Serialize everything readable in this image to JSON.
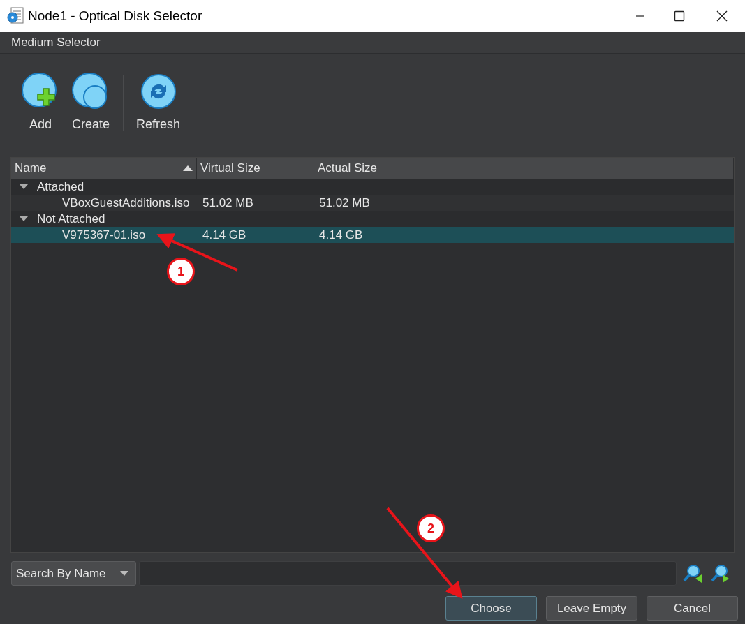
{
  "window": {
    "title": "Node1 - Optical Disk Selector"
  },
  "menu": [
    "Medium Selector"
  ],
  "toolbar": [
    {
      "label": "Add",
      "kind": "add"
    },
    {
      "label": "Create",
      "kind": "create"
    },
    {
      "label": "Refresh",
      "kind": "refresh"
    }
  ],
  "table": {
    "columns": [
      {
        "label": "Name",
        "sorted": true
      },
      {
        "label": "Virtual Size",
        "sorted": false
      },
      {
        "label": "Actual Size",
        "sorted": false
      }
    ],
    "groups": [
      {
        "label": "Attached",
        "expanded": true,
        "children": [
          {
            "name": "VBoxGuestAdditions.iso",
            "virtual_size": "51.02 MB",
            "actual_size": "51.02 MB",
            "selected": false
          }
        ]
      },
      {
        "label": "Not Attached",
        "expanded": true,
        "children": [
          {
            "name": "V975367-01.iso",
            "virtual_size": "4.14 GB",
            "actual_size": "4.14 GB",
            "selected": true
          }
        ]
      }
    ]
  },
  "search": {
    "mode": "Search By Name"
  },
  "buttons": [
    {
      "label": "Choose",
      "default": true
    },
    {
      "label": "Leave Empty",
      "default": false
    },
    {
      "label": "Cancel",
      "default": false
    }
  ],
  "annotations": [
    {
      "label": "1"
    },
    {
      "label": "2"
    }
  ]
}
